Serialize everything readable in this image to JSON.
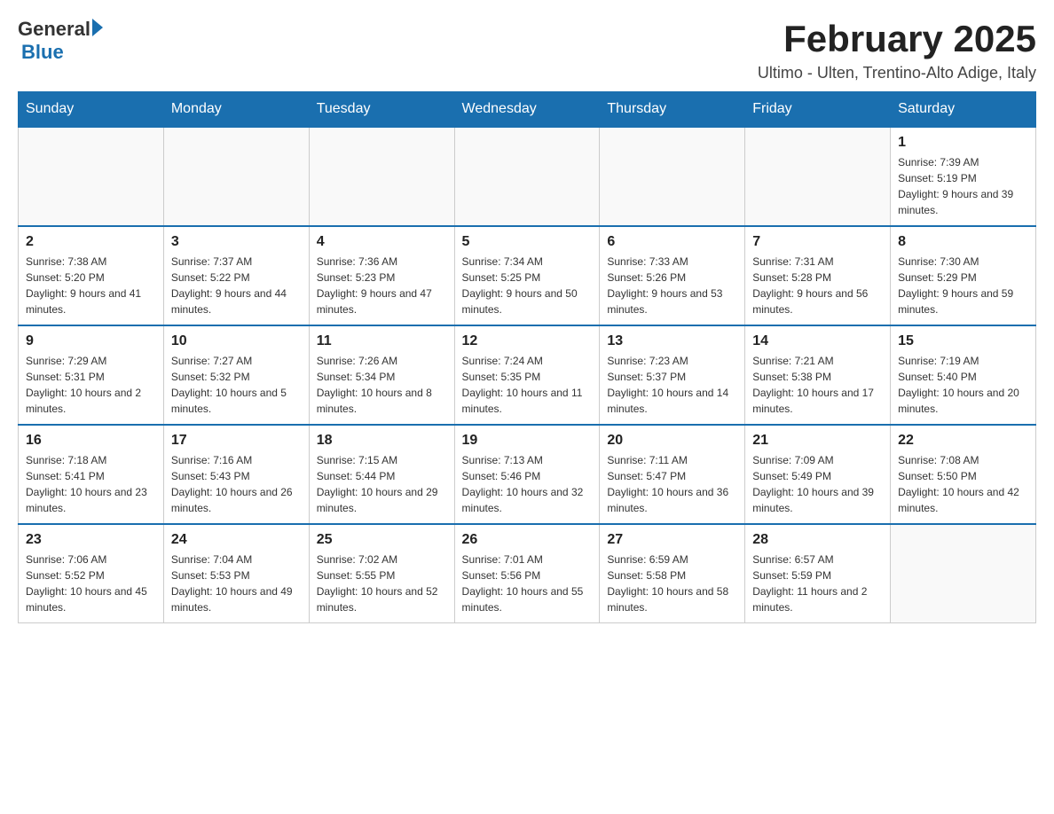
{
  "header": {
    "logo_general": "General",
    "logo_blue": "Blue",
    "title": "February 2025",
    "subtitle": "Ultimo - Ulten, Trentino-Alto Adige, Italy"
  },
  "calendar": {
    "days_of_week": [
      "Sunday",
      "Monday",
      "Tuesday",
      "Wednesday",
      "Thursday",
      "Friday",
      "Saturday"
    ],
    "weeks": [
      {
        "days": [
          {
            "date": "",
            "info": ""
          },
          {
            "date": "",
            "info": ""
          },
          {
            "date": "",
            "info": ""
          },
          {
            "date": "",
            "info": ""
          },
          {
            "date": "",
            "info": ""
          },
          {
            "date": "",
            "info": ""
          },
          {
            "date": "1",
            "info": "Sunrise: 7:39 AM\nSunset: 5:19 PM\nDaylight: 9 hours and 39 minutes."
          }
        ]
      },
      {
        "days": [
          {
            "date": "2",
            "info": "Sunrise: 7:38 AM\nSunset: 5:20 PM\nDaylight: 9 hours and 41 minutes."
          },
          {
            "date": "3",
            "info": "Sunrise: 7:37 AM\nSunset: 5:22 PM\nDaylight: 9 hours and 44 minutes."
          },
          {
            "date": "4",
            "info": "Sunrise: 7:36 AM\nSunset: 5:23 PM\nDaylight: 9 hours and 47 minutes."
          },
          {
            "date": "5",
            "info": "Sunrise: 7:34 AM\nSunset: 5:25 PM\nDaylight: 9 hours and 50 minutes."
          },
          {
            "date": "6",
            "info": "Sunrise: 7:33 AM\nSunset: 5:26 PM\nDaylight: 9 hours and 53 minutes."
          },
          {
            "date": "7",
            "info": "Sunrise: 7:31 AM\nSunset: 5:28 PM\nDaylight: 9 hours and 56 minutes."
          },
          {
            "date": "8",
            "info": "Sunrise: 7:30 AM\nSunset: 5:29 PM\nDaylight: 9 hours and 59 minutes."
          }
        ]
      },
      {
        "days": [
          {
            "date": "9",
            "info": "Sunrise: 7:29 AM\nSunset: 5:31 PM\nDaylight: 10 hours and 2 minutes."
          },
          {
            "date": "10",
            "info": "Sunrise: 7:27 AM\nSunset: 5:32 PM\nDaylight: 10 hours and 5 minutes."
          },
          {
            "date": "11",
            "info": "Sunrise: 7:26 AM\nSunset: 5:34 PM\nDaylight: 10 hours and 8 minutes."
          },
          {
            "date": "12",
            "info": "Sunrise: 7:24 AM\nSunset: 5:35 PM\nDaylight: 10 hours and 11 minutes."
          },
          {
            "date": "13",
            "info": "Sunrise: 7:23 AM\nSunset: 5:37 PM\nDaylight: 10 hours and 14 minutes."
          },
          {
            "date": "14",
            "info": "Sunrise: 7:21 AM\nSunset: 5:38 PM\nDaylight: 10 hours and 17 minutes."
          },
          {
            "date": "15",
            "info": "Sunrise: 7:19 AM\nSunset: 5:40 PM\nDaylight: 10 hours and 20 minutes."
          }
        ]
      },
      {
        "days": [
          {
            "date": "16",
            "info": "Sunrise: 7:18 AM\nSunset: 5:41 PM\nDaylight: 10 hours and 23 minutes."
          },
          {
            "date": "17",
            "info": "Sunrise: 7:16 AM\nSunset: 5:43 PM\nDaylight: 10 hours and 26 minutes."
          },
          {
            "date": "18",
            "info": "Sunrise: 7:15 AM\nSunset: 5:44 PM\nDaylight: 10 hours and 29 minutes."
          },
          {
            "date": "19",
            "info": "Sunrise: 7:13 AM\nSunset: 5:46 PM\nDaylight: 10 hours and 32 minutes."
          },
          {
            "date": "20",
            "info": "Sunrise: 7:11 AM\nSunset: 5:47 PM\nDaylight: 10 hours and 36 minutes."
          },
          {
            "date": "21",
            "info": "Sunrise: 7:09 AM\nSunset: 5:49 PM\nDaylight: 10 hours and 39 minutes."
          },
          {
            "date": "22",
            "info": "Sunrise: 7:08 AM\nSunset: 5:50 PM\nDaylight: 10 hours and 42 minutes."
          }
        ]
      },
      {
        "days": [
          {
            "date": "23",
            "info": "Sunrise: 7:06 AM\nSunset: 5:52 PM\nDaylight: 10 hours and 45 minutes."
          },
          {
            "date": "24",
            "info": "Sunrise: 7:04 AM\nSunset: 5:53 PM\nDaylight: 10 hours and 49 minutes."
          },
          {
            "date": "25",
            "info": "Sunrise: 7:02 AM\nSunset: 5:55 PM\nDaylight: 10 hours and 52 minutes."
          },
          {
            "date": "26",
            "info": "Sunrise: 7:01 AM\nSunset: 5:56 PM\nDaylight: 10 hours and 55 minutes."
          },
          {
            "date": "27",
            "info": "Sunrise: 6:59 AM\nSunset: 5:58 PM\nDaylight: 10 hours and 58 minutes."
          },
          {
            "date": "28",
            "info": "Sunrise: 6:57 AM\nSunset: 5:59 PM\nDaylight: 11 hours and 2 minutes."
          },
          {
            "date": "",
            "info": ""
          }
        ]
      }
    ]
  }
}
